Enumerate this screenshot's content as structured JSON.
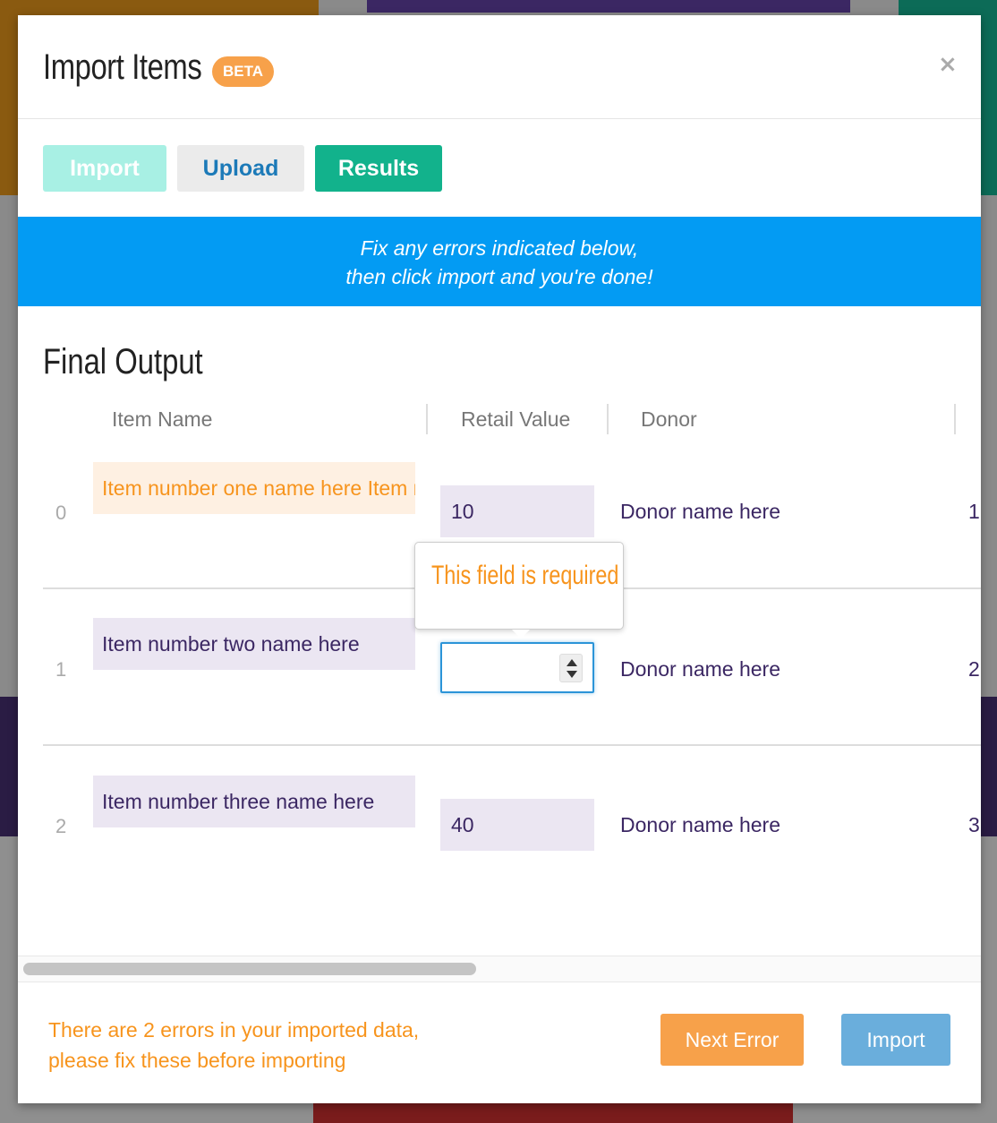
{
  "modal": {
    "title": "Import Items",
    "badge": "BETA",
    "close_symbol": "×"
  },
  "tabs": [
    {
      "label": "Import",
      "state": "disabled"
    },
    {
      "label": "Upload",
      "state": "default"
    },
    {
      "label": "Results",
      "state": "active"
    }
  ],
  "info_banner": {
    "line1": "Fix any errors indicated below,",
    "line2": "then click import and you're done!"
  },
  "section": {
    "title": "Final Output"
  },
  "table": {
    "columns": [
      "Item Name",
      "Retail Value",
      "Donor"
    ],
    "rows": [
      {
        "index": "0",
        "item_name": "Item number one name here Item number one name here",
        "retail_value": "10",
        "donor": "Donor name here",
        "extra": "1",
        "item_name_error": true
      },
      {
        "index": "1",
        "item_name": "Item number two name here",
        "retail_value": "",
        "donor": "Donor name here",
        "extra": "2",
        "retail_value_error": true
      },
      {
        "index": "2",
        "item_name": "Item number three name here",
        "retail_value": "40",
        "donor": "Donor name here",
        "extra": "3"
      }
    ]
  },
  "tooltip": {
    "text": "This field is required"
  },
  "footer": {
    "error_line1": "There are 2 errors in your imported data,",
    "error_line2": "please fix these before importing",
    "next_error_label": "Next Error",
    "import_label": "Import"
  },
  "colors": {
    "accent_green": "#12b28c",
    "info_blue": "#039bf3",
    "warning_orange": "#f7941d",
    "cell_purple": "#ebe6f2",
    "text_purple": "#3b2763"
  },
  "icons": [
    "close-icon",
    "spinner-up-icon",
    "spinner-down-icon"
  ]
}
